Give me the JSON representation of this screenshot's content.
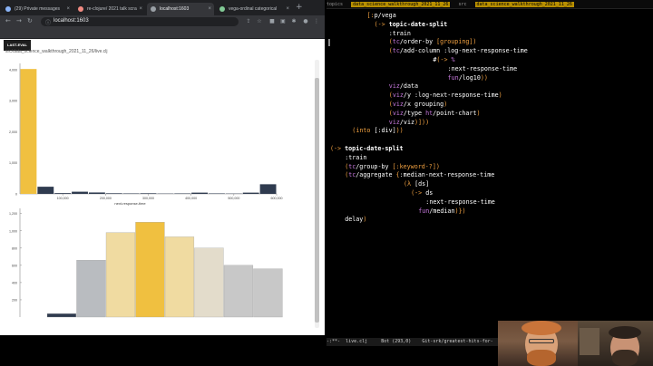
{
  "browser": {
    "tabs": [
      {
        "label": "(29) Private messages",
        "active": false
      },
      {
        "label": "re-clojure/ 2021 talk scra",
        "active": false
      },
      {
        "label": "localhost:1603",
        "active": true
      },
      {
        "label": "vega-ordinal categorical",
        "active": false
      }
    ],
    "url": "localhost:1603",
    "last_eval_label": "LAST-EVAL",
    "file_path": "src/data_science_walkthrough_2021_11_26/live.clj"
  },
  "chart_data": [
    {
      "type": "bar",
      "title": "",
      "xlabel": "next-response-time",
      "ylabel": "",
      "x_ticks": [
        "100,000",
        "200,000",
        "300,000",
        "400,000",
        "500,000",
        "600,000"
      ],
      "y_ticks": [
        "0",
        "1,000",
        "2,000",
        "3,000",
        "4,000"
      ],
      "ylim": [
        0,
        4200
      ],
      "xlim": [
        0,
        600000
      ],
      "bins": [
        {
          "x0": 0,
          "x1": 40000,
          "value": 4020,
          "color": "#f0c040"
        },
        {
          "x0": 40000,
          "x1": 80000,
          "value": 230,
          "color": "#2f3b4f"
        },
        {
          "x0": 80000,
          "x1": 120000,
          "value": 25,
          "color": "#2f3b4f"
        },
        {
          "x0": 120000,
          "x1": 160000,
          "value": 70,
          "color": "#2f3b4f"
        },
        {
          "x0": 160000,
          "x1": 200000,
          "value": 45,
          "color": "#2f3b4f"
        },
        {
          "x0": 200000,
          "x1": 240000,
          "value": 20,
          "color": "#2f3b4f"
        },
        {
          "x0": 240000,
          "x1": 280000,
          "value": 15,
          "color": "#2f3b4f"
        },
        {
          "x0": 280000,
          "x1": 320000,
          "value": 20,
          "color": "#2f3b4f"
        },
        {
          "x0": 320000,
          "x1": 360000,
          "value": 10,
          "color": "#2f3b4f"
        },
        {
          "x0": 360000,
          "x1": 400000,
          "value": 15,
          "color": "#2f3b4f"
        },
        {
          "x0": 400000,
          "x1": 440000,
          "value": 40,
          "color": "#2f3b4f"
        },
        {
          "x0": 440000,
          "x1": 480000,
          "value": 15,
          "color": "#2f3b4f"
        },
        {
          "x0": 480000,
          "x1": 520000,
          "value": 10,
          "color": "#2f3b4f"
        },
        {
          "x0": 520000,
          "x1": 560000,
          "value": 40,
          "color": "#2f3b4f"
        },
        {
          "x0": 560000,
          "x1": 600000,
          "value": 310,
          "color": "#2f3b4f"
        }
      ]
    },
    {
      "type": "bar",
      "title": "",
      "xlabel": "",
      "ylabel": "",
      "y_ticks": [
        "200",
        "400",
        "600",
        "800",
        "1,000",
        "1,200"
      ],
      "ylim": [
        0,
        1260
      ],
      "values": [
        40,
        660,
        980,
        1100,
        930,
        800,
        600,
        560
      ],
      "colors": [
        "#2f3b4f",
        "#b9bcc0",
        "#f0dba1",
        "#f0c040",
        "#f0dba1",
        "#e3dccb",
        "#c8c8c8",
        "#c8c8c8"
      ]
    }
  ],
  "editor": {
    "tabs": [
      "topics",
      "data_science_walkthrough_2021_11_26",
      "src",
      "data_science_walkthrough_2021_11_26"
    ],
    "code_lines": [
      {
        "indent": 5,
        "parts": [
          [
            "p",
            "[:"
          ],
          [
            "n",
            "p/vega"
          ]
        ]
      },
      {
        "indent": 6,
        "parts": [
          [
            "p",
            "(->"
          ],
          [
            "k",
            " topic-date-split"
          ]
        ]
      },
      {
        "indent": 8,
        "parts": [
          [
            "n",
            ":train"
          ]
        ]
      },
      {
        "indent": 8,
        "parts": [
          [
            "p",
            "("
          ],
          [
            "s",
            "tc"
          ],
          [
            "n",
            "/order-by "
          ],
          [
            "p",
            "[grouping])"
          ]
        ]
      },
      {
        "indent": 8,
        "parts": [
          [
            "p",
            "("
          ],
          [
            "s",
            "tc"
          ],
          [
            "n",
            "/add-column "
          ],
          [
            "n",
            ":log-next-response-time"
          ]
        ]
      },
      {
        "indent": 14,
        "parts": [
          [
            "n",
            "#"
          ],
          [
            "p",
            "(->"
          ],
          [
            "s",
            " %"
          ]
        ]
      },
      {
        "indent": 16,
        "parts": [
          [
            "n",
            ":next-response-time"
          ]
        ]
      },
      {
        "indent": 16,
        "parts": [
          [
            "s",
            "fun"
          ],
          [
            "n",
            "/log10"
          ],
          [
            "p",
            "))"
          ]
        ]
      },
      {
        "indent": 8,
        "parts": [
          [
            "s",
            "viz"
          ],
          [
            "n",
            "/data"
          ]
        ]
      },
      {
        "indent": 8,
        "parts": [
          [
            "p",
            "("
          ],
          [
            "s",
            "viz"
          ],
          [
            "n",
            "/y "
          ],
          [
            "n",
            ":log-next-response-time"
          ],
          [
            "p",
            ")"
          ]
        ]
      },
      {
        "indent": 8,
        "parts": [
          [
            "p",
            "("
          ],
          [
            "s",
            "viz"
          ],
          [
            "n",
            "/x grouping"
          ],
          [
            "p",
            ")"
          ]
        ]
      },
      {
        "indent": 8,
        "parts": [
          [
            "p",
            "("
          ],
          [
            "s",
            "viz"
          ],
          [
            "n",
            "/type "
          ],
          [
            "s",
            "ht"
          ],
          [
            "n",
            "/point-chart"
          ],
          [
            "p",
            ")"
          ]
        ]
      },
      {
        "indent": 8,
        "parts": [
          [
            "s",
            "viz"
          ],
          [
            "n",
            "/viz"
          ],
          [
            "p",
            ")]))"
          ]
        ]
      },
      {
        "indent": 3,
        "parts": [
          [
            "p",
            "(into "
          ],
          [
            "n",
            "[:div]"
          ],
          [
            "p",
            "))"
          ]
        ]
      },
      {
        "indent": 0,
        "parts": []
      },
      {
        "indent": 0,
        "parts": [
          [
            "p",
            "(->"
          ],
          [
            "k",
            " topic-date-split"
          ]
        ]
      },
      {
        "indent": 2,
        "parts": [
          [
            "n",
            ":train"
          ]
        ]
      },
      {
        "indent": 2,
        "parts": [
          [
            "p",
            "("
          ],
          [
            "s",
            "tc"
          ],
          [
            "n",
            "/group-by "
          ],
          [
            "p",
            "[:keyword-?])"
          ]
        ]
      },
      {
        "indent": 2,
        "parts": [
          [
            "p",
            "("
          ],
          [
            "s",
            "tc"
          ],
          [
            "n",
            "/aggregate "
          ],
          [
            "p",
            "{"
          ],
          [
            "n",
            ":median-next-response-time"
          ]
        ]
      },
      {
        "indent": 10,
        "parts": [
          [
            "p",
            "(λ "
          ],
          [
            "n",
            "[ds]"
          ]
        ]
      },
      {
        "indent": 11,
        "parts": [
          [
            "p",
            "(->"
          ],
          [
            "n",
            " ds"
          ]
        ]
      },
      {
        "indent": 13,
        "parts": [
          [
            "n",
            ":next-response-time"
          ]
        ]
      },
      {
        "indent": 12,
        "parts": [
          [
            "s",
            "fun"
          ],
          [
            "n",
            "/median"
          ],
          [
            "p",
            ")})"
          ]
        ]
      },
      {
        "indent": 2,
        "parts": [
          [
            "n",
            "delay"
          ],
          [
            "p",
            ")"
          ]
        ]
      }
    ],
    "modeline": "-:**-  live.clj     Bot (293,0)    Git-srk/greatest-hits-for-"
  }
}
